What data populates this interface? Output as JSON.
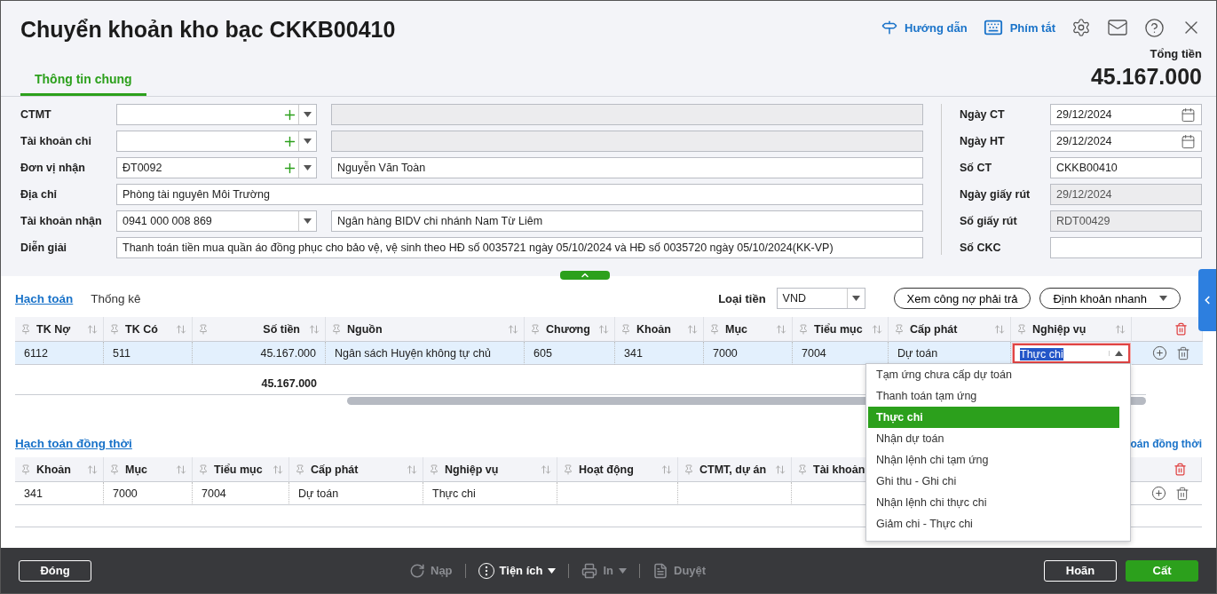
{
  "title": "Chuyển khoản kho bạc CKKB00410",
  "toolbar": [
    {
      "kind": "guide",
      "label": "Hướng dẫn"
    },
    {
      "kind": "shortcuts",
      "label": "Phím tắt"
    }
  ],
  "total": {
    "label": "Tổng tiền",
    "value": "45.167.000"
  },
  "tabs": [
    {
      "label": "Thông tin chung",
      "selected": true
    }
  ],
  "form_left": [
    {
      "label": "CTMT",
      "kind": "combo",
      "name_disabled": true
    },
    {
      "label": "Tài khoản chi",
      "kind": "combo",
      "name_disabled": true
    },
    {
      "label": "Đơn vị nhận",
      "kind": "combo",
      "code": "ĐT0092",
      "name": "Nguyễn Văn Toàn",
      "name_disabled": false
    },
    {
      "label": "Địa chỉ",
      "kind": "text",
      "value": "Phòng tài nguyên Môi Trường"
    },
    {
      "label": "Tài khoản nhận",
      "kind": "select",
      "code": "0941 000 008 869",
      "name": "Ngân hàng BIDV chi nhánh Nam Từ Liêm",
      "name_disabled": false
    },
    {
      "label": "Diễn giải",
      "kind": "text",
      "value": "Thanh toán tiền mua quần áo đồng phục cho bảo vệ, vệ sinh theo HĐ số 0035721 ngày 05/10/2024 và HĐ số 0035720 ngày 05/10/2024(KK-VP)"
    }
  ],
  "form_right": [
    {
      "label": "Ngày CT",
      "kind": "date",
      "value": "29/12/2024",
      "disabled": false
    },
    {
      "label": "Ngày HT",
      "kind": "date",
      "value": "29/12/2024",
      "disabled": false
    },
    {
      "label": "Số CT",
      "kind": "text",
      "value": "CKKB00410",
      "disabled": false
    },
    {
      "label": "Ngày giấy rút",
      "kind": "text",
      "value": "29/12/2024",
      "disabled": true
    },
    {
      "label": "Số giấy rút",
      "kind": "text",
      "value": "RDT00429",
      "disabled": true
    },
    {
      "label": "Số CKC",
      "kind": "text",
      "disabled": false
    }
  ],
  "detail_tabs": [
    {
      "label": "Hạch toán",
      "selected": true
    },
    {
      "label": "Thống kê",
      "selected": false
    }
  ],
  "currency": {
    "label": "Loại tiền",
    "value": "VND"
  },
  "debt_button": "Xem công nợ phải trả",
  "quick_entry": "Định khoản nhanh",
  "grid1": {
    "columns": [
      {
        "label": "TK Nợ",
        "kind": "text"
      },
      {
        "label": "TK Có",
        "kind": "text"
      },
      {
        "label": "Số tiền",
        "kind": "amount"
      },
      {
        "label": "Nguồn",
        "kind": "text"
      },
      {
        "label": "Chương",
        "kind": "text"
      },
      {
        "label": "Khoản",
        "kind": "text"
      },
      {
        "label": "Mục",
        "kind": "text"
      },
      {
        "label": "Tiểu mục",
        "kind": "text"
      },
      {
        "label": "Cấp phát",
        "kind": "text"
      },
      {
        "label": "Nghiệp vụ",
        "kind": "text"
      }
    ],
    "rows": [
      {
        "cells": [
          "6112",
          "511",
          "45.167.000",
          "Ngân sách Huyện không tự chủ",
          "605",
          "341",
          "7000",
          "7004",
          "Dự toán",
          "Thực chi"
        ],
        "selected": true,
        "editing": true
      }
    ],
    "total": "45.167.000"
  },
  "grid2_title": "Hạch toán đồng thời",
  "grid2_link": "oán đồng thời",
  "grid2": {
    "columns": [
      {
        "label": "Khoản",
        "kind": "text"
      },
      {
        "label": "Mục",
        "kind": "text"
      },
      {
        "label": "Tiểu mục",
        "kind": "text"
      },
      {
        "label": "Cấp phát",
        "kind": "text"
      },
      {
        "label": "Nghiệp vụ",
        "kind": "text"
      },
      {
        "label": "Hoạt động",
        "kind": "text"
      },
      {
        "label": "CTMT, dự án",
        "kind": "text"
      },
      {
        "label": "Tài khoản",
        "kind": "text"
      }
    ],
    "rows": [
      {
        "cells": [
          "341",
          "7000",
          "7004",
          "Dự toán",
          "Thực chi"
        ],
        "selected": false
      }
    ]
  },
  "dropdown": [
    {
      "label": "Tạm ứng chưa cấp dự toán",
      "selected": false
    },
    {
      "label": "Thanh toán tạm ứng",
      "selected": false
    },
    {
      "label": "Thực chi",
      "selected": true
    },
    {
      "label": "Nhận dự toán",
      "selected": false
    },
    {
      "label": "Nhận lệnh chi tạm ứng",
      "selected": false
    },
    {
      "label": "Ghi thu - Ghi chi",
      "selected": false
    },
    {
      "label": "Nhận lệnh chi thực chi",
      "selected": false
    },
    {
      "label": "Giảm chi - Thực chi",
      "selected": false
    }
  ],
  "footer": {
    "close": "Đóng",
    "actions": [
      {
        "kind": "reload",
        "label": "Nạp",
        "disabled": true,
        "menu": false
      },
      {
        "kind": "utility",
        "label": "Tiện ích",
        "disabled": false,
        "menu": true
      },
      {
        "kind": "print",
        "label": "In",
        "disabled": true,
        "menu": true
      },
      {
        "kind": "approve",
        "label": "Duyệt",
        "disabled": true,
        "menu": false
      }
    ],
    "cancel": "Hoãn",
    "save": "Cất"
  }
}
